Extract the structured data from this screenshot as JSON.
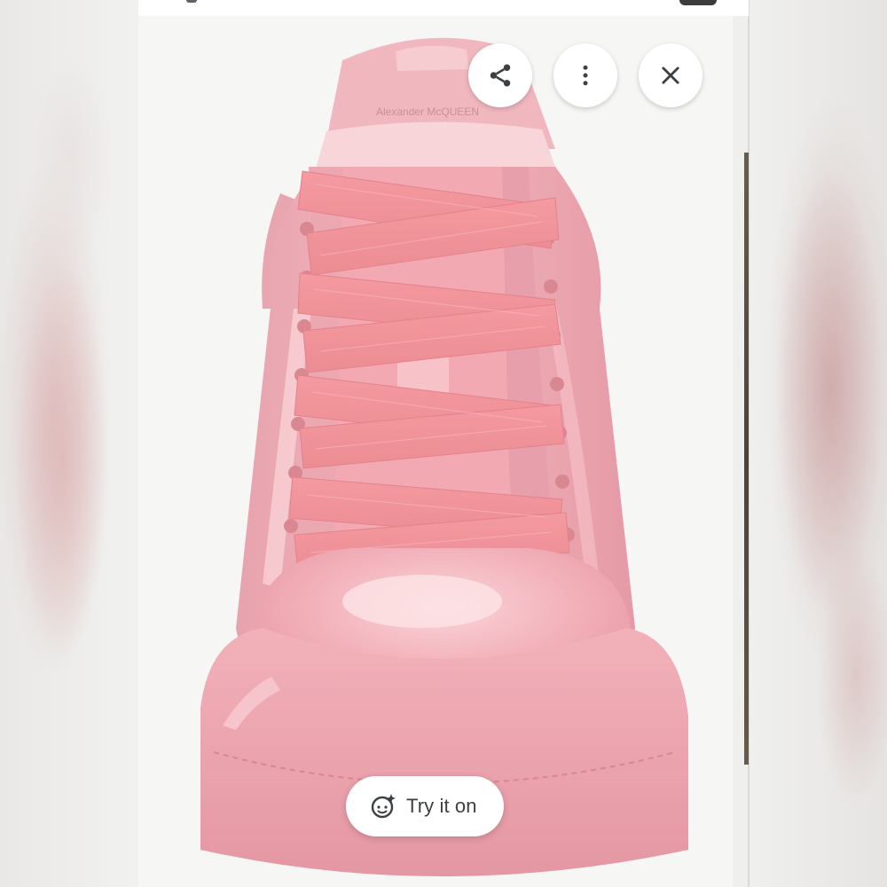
{
  "viewer": {
    "product_image_alt": "Pink patent leather sneaker with wide pink laces, front view",
    "brand_text": "Alexander McQUEEN",
    "accent_color": "#e79aa0",
    "surface_color": "#ffffff",
    "icon_color": "#3c4043"
  },
  "actions": {
    "share_icon": "share-icon",
    "more_icon": "more-vert-icon",
    "close_icon": "close-icon"
  },
  "try_on": {
    "label": "Try it on",
    "icon": "face-sparkle-icon"
  }
}
